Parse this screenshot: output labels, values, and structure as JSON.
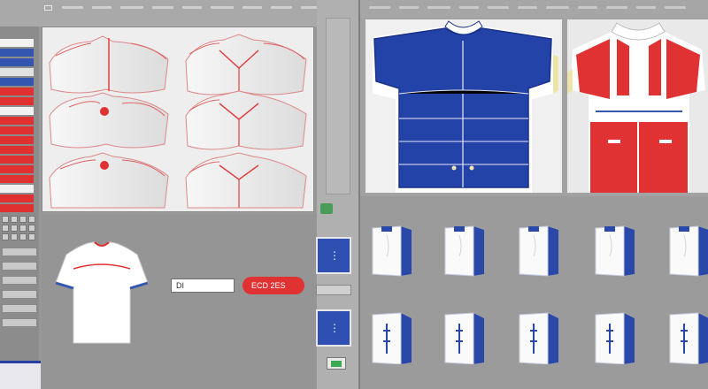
{
  "app": {
    "left_field_value": "DI",
    "apply_button_label": "ECD 2ES"
  },
  "colors": {
    "accent_red": "#e03232",
    "accent_blue": "#2f4fb3",
    "panel_gray": "#989898",
    "canvas_bg": "#eeeeee"
  },
  "sidebar": {
    "swatches": [
      "#f2f2f2",
      "#3357b0",
      "#3357b0",
      "#e2e2e2",
      "#3357b0",
      "#e03030",
      "#e03030",
      "#f2f2f2",
      "#e03030",
      "#e03030",
      "#e03030",
      "#e03030",
      "#e03030",
      "#e03030",
      "#e03030",
      "#f0f0f0",
      "#e03030",
      "#e03030"
    ]
  },
  "icons": {
    "toolbar": "window-icon",
    "thumb_top": "pattern-icon",
    "thumb_mid": "pattern-icon",
    "bottom": "image-icon"
  }
}
